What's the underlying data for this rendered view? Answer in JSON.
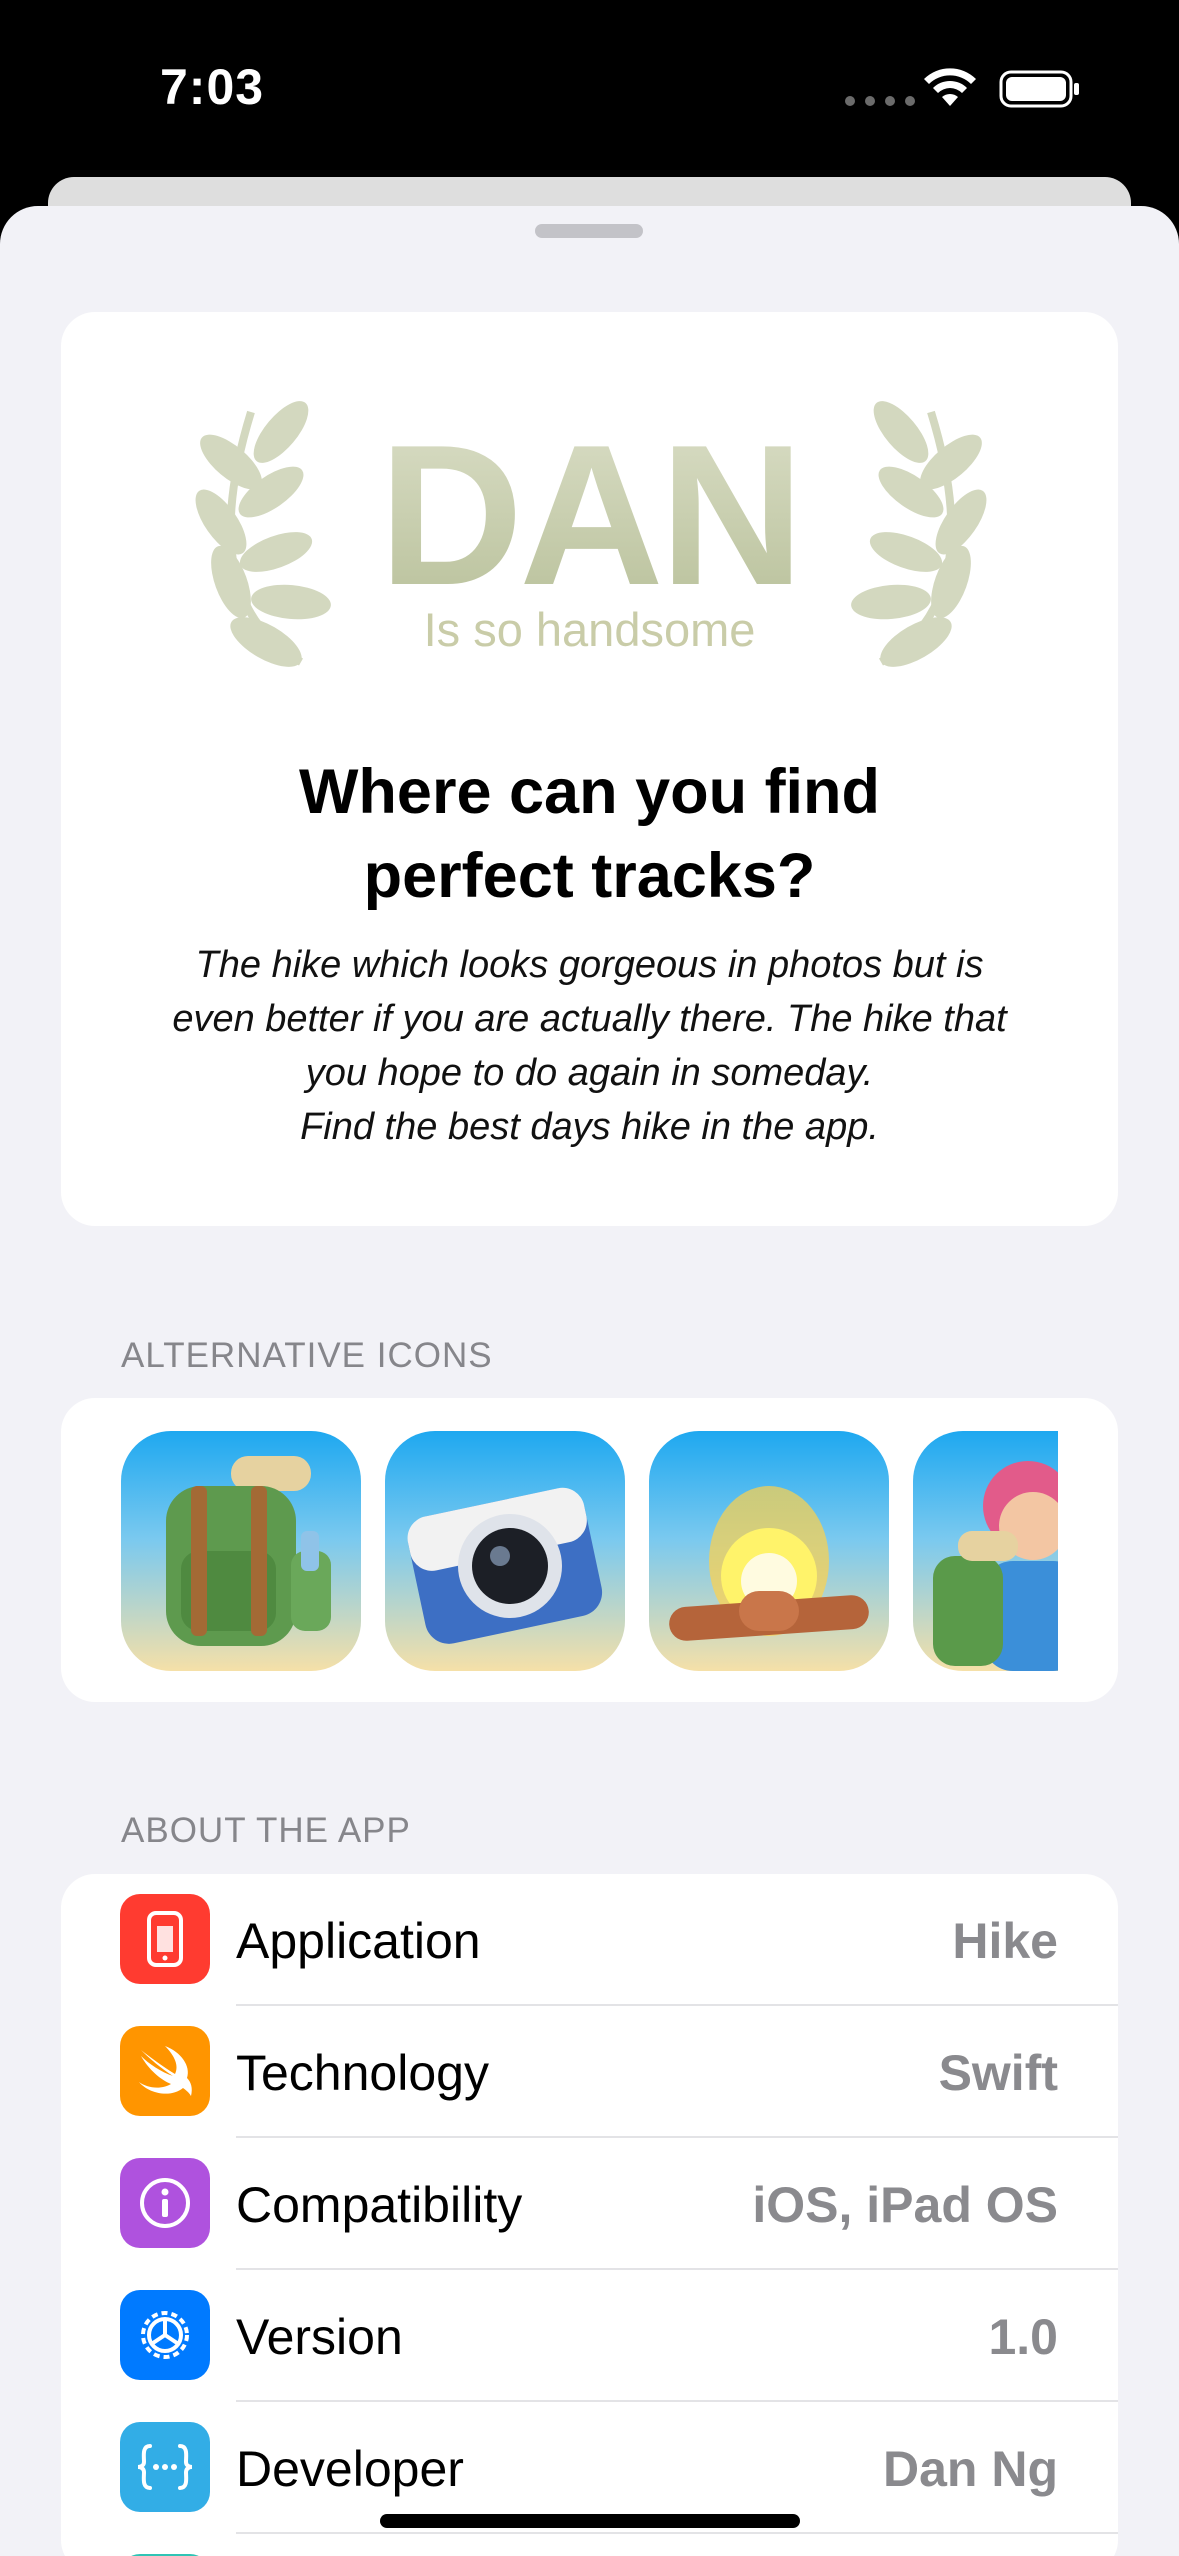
{
  "status": {
    "time": "7:03"
  },
  "header": {
    "brand": "DAN",
    "brand_subtitle": "Is so handsome",
    "headline": "Where can you find perfect tracks?",
    "body_line1": "The hike which looks gorgeous in photos but is",
    "body_line2": "even better if you are actually there. The hike that",
    "body_line3": "you hope to do again in someday.",
    "body_line4": "Find the best days hike in the app."
  },
  "alt_icons": {
    "section_title": "ALTERNATIVE ICONS",
    "icons": [
      "backpack-icon",
      "camera-icon",
      "campfire-icon",
      "hiker-icon"
    ]
  },
  "about": {
    "section_title": "ABOUT THE APP",
    "rows": [
      {
        "label": "Application",
        "value": "Hike",
        "icon": "iphone-icon",
        "color": "#ff3b30"
      },
      {
        "label": "Technology",
        "value": "Swift",
        "icon": "swift-icon",
        "color": "#ff9500"
      },
      {
        "label": "Compatibility",
        "value": "iOS, iPad OS",
        "icon": "info-icon",
        "color": "#af52de"
      },
      {
        "label": "Version",
        "value": "1.0",
        "icon": "gear-icon",
        "color": "#007aff"
      },
      {
        "label": "Developer",
        "value": "Dan Ng",
        "icon": "curlybraces-icon",
        "color": "#32ade6"
      }
    ]
  }
}
